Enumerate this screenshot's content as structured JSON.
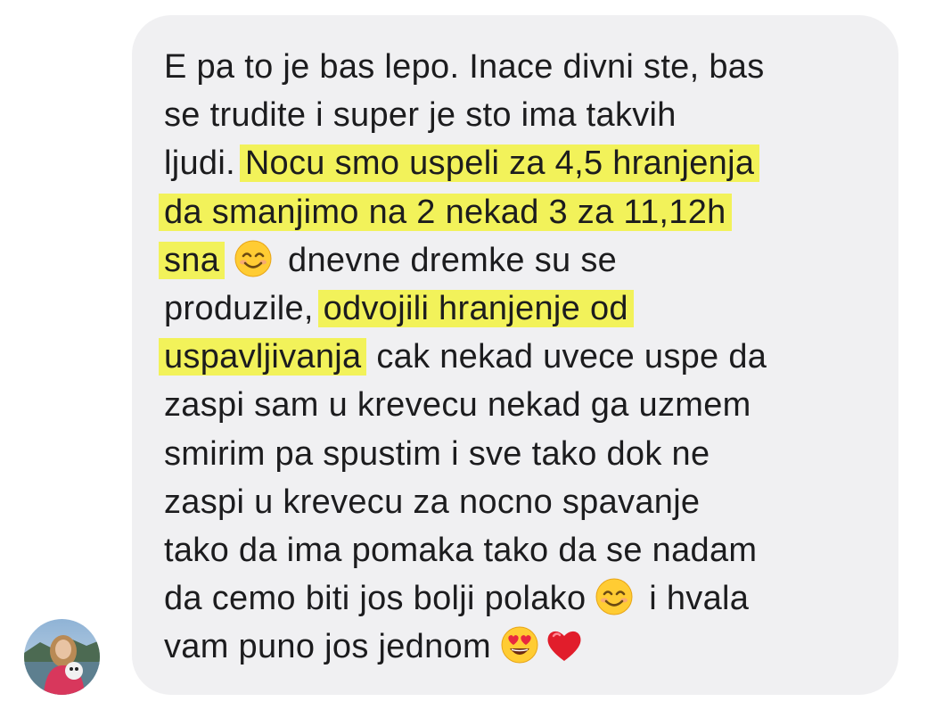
{
  "message": {
    "lines": [
      {
        "text": "E pa to je bas lepo. Inace divni ste, bas"
      },
      {
        "text": "se trudite i super je sto ima takvih"
      },
      {
        "pre": "ljudi. ",
        "hl": "Nocu smo uspeli za 4,5 hranjenja"
      },
      {
        "hl": "da smanjimo na 2 nekad 3 za 11,12h"
      },
      {
        "hl": "sna",
        "post": " dnevne dremke su se"
      },
      {
        "pre": "produzile, ",
        "hl": "odvojili hranjenje od"
      },
      {
        "hl": "uspavljivanja",
        "post": " cak nekad uvece uspe da"
      },
      {
        "text": "zaspi sam u krevecu nekad ga uzmem"
      },
      {
        "text": "smirim pa spustim i sve tako dok ne"
      },
      {
        "text": "zaspi u krevecu za nocno spavanje"
      },
      {
        "text": "tako da ima pomaka tako da se nadam"
      },
      {
        "pre": "da cemo biti jos bolji polako",
        "post": " i hvala"
      },
      {
        "pre": "vam puno jos jednom"
      }
    ]
  },
  "emojis": {
    "smile_1": "smiling-face-emoji",
    "smile_2": "smiling-face-emoji",
    "heart_eyes": "heart-eyes-emoji",
    "heart": "red-heart-emoji"
  },
  "colors": {
    "bubble_background": "#f0f0f2",
    "highlight": "#f2f25a",
    "text": "#1c1c1e"
  }
}
